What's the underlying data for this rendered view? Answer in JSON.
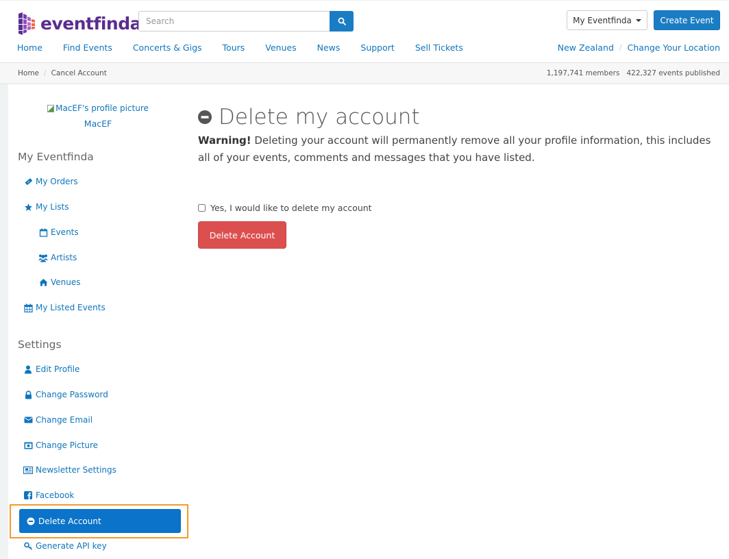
{
  "brand": {
    "name": "eventfinda",
    "color": "#5b2d8e"
  },
  "search": {
    "placeholder": "Search",
    "value": ""
  },
  "header_buttons": {
    "my_eventfinda": "My Eventfinda",
    "create_event": "Create Event"
  },
  "nav": {
    "items": [
      "Home",
      "Find Events",
      "Concerts & Gigs",
      "Tours",
      "Venues",
      "News",
      "Support",
      "Sell Tickets"
    ]
  },
  "location": {
    "region": "New Zealand",
    "separator": "/",
    "change": "Change Your Location"
  },
  "breadcrumb": {
    "items": [
      "Home",
      "Cancel Account"
    ],
    "separator": "/"
  },
  "stats": {
    "members": "1,197,741 members",
    "events": "422,327 events published"
  },
  "profile": {
    "picture_alt": "MacEF's profile picture",
    "username": "MacEF"
  },
  "sidebar": {
    "my_eventfinda_title": "My Eventfinda",
    "my_eventfinda_items": [
      {
        "label": "My Orders",
        "icon": "ticket-icon"
      },
      {
        "label": "My Lists",
        "icon": "star-icon"
      },
      {
        "label": "Events",
        "icon": "calendar-icon"
      },
      {
        "label": "Artists",
        "icon": "users-icon"
      },
      {
        "label": "Venues",
        "icon": "home-icon"
      },
      {
        "label": "My Listed Events",
        "icon": "calendar-grid-icon"
      }
    ],
    "settings_title": "Settings",
    "settings_items": [
      {
        "label": "Edit Profile",
        "icon": "user-icon"
      },
      {
        "label": "Change Password",
        "icon": "lock-icon"
      },
      {
        "label": "Change Email",
        "icon": "envelope-icon"
      },
      {
        "label": "Change Picture",
        "icon": "picture-icon"
      },
      {
        "label": "Newsletter Settings",
        "icon": "newspaper-icon"
      },
      {
        "label": "Facebook",
        "icon": "facebook-icon"
      },
      {
        "label": "Delete Account",
        "icon": "minus-circle-icon",
        "active": true
      },
      {
        "label": "Generate API key",
        "icon": "key-icon"
      }
    ]
  },
  "main": {
    "title": "Delete my account",
    "warning_label": "Warning!",
    "warning_text": " Deleting your account will permanently remove all your profile information, this includes all of your events, comments and messages that you have listed.",
    "confirm_label": "Yes, I would like to delete my account",
    "confirm_checked": false,
    "delete_button": "Delete Account"
  },
  "colors": {
    "link": "#0f75bc",
    "primary": "#1a7dc4",
    "active_item": "#0b73c9",
    "danger": "#dc4f4f",
    "highlight_outline": "#f39a2b"
  }
}
